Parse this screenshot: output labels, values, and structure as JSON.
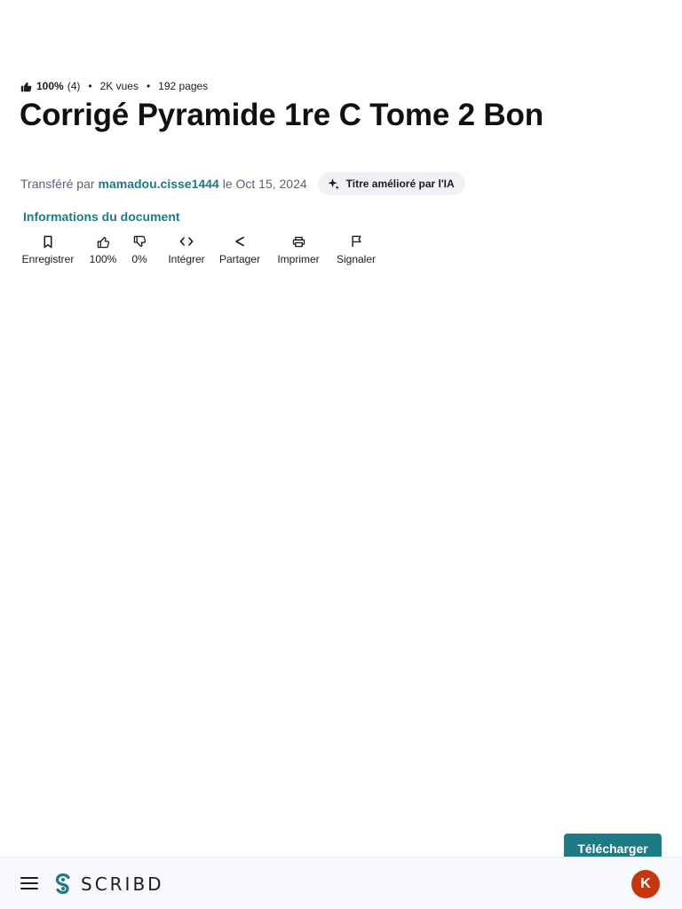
{
  "meta": {
    "rating_pct": "100%",
    "rating_count": "(4)",
    "views": "2K vues",
    "pages": "192 pages"
  },
  "document": {
    "title": "Corrigé Pyramide 1re C Tome 2 Bon"
  },
  "uploader": {
    "prefix": "Transféré par",
    "username": "mamadou.cisse1444",
    "date_text": "le Oct 15, 2024",
    "ai_chip": "Titre amélioré par l'IA"
  },
  "doc_info_link": "Informations du document",
  "actions": [
    {
      "label": "Enregistrer",
      "icon": "bookmark-icon"
    },
    {
      "label": "100%",
      "icon": "thumbs-up-icon"
    },
    {
      "label": "0%",
      "icon": "thumbs-down-icon"
    },
    {
      "label": "Intégrer",
      "icon": "embed-code-icon"
    },
    {
      "label": "Partager",
      "icon": "share-icon"
    },
    {
      "label": "Imprimer",
      "icon": "print-icon"
    },
    {
      "label": "Signaler",
      "icon": "flag-icon"
    }
  ],
  "download_button": "Télécharger",
  "bottom_bar": {
    "logo_text": "SCRIBD",
    "avatar_initial": "K",
    "accent_color": "#1e7b85",
    "avatar_color": "#c6370f"
  }
}
